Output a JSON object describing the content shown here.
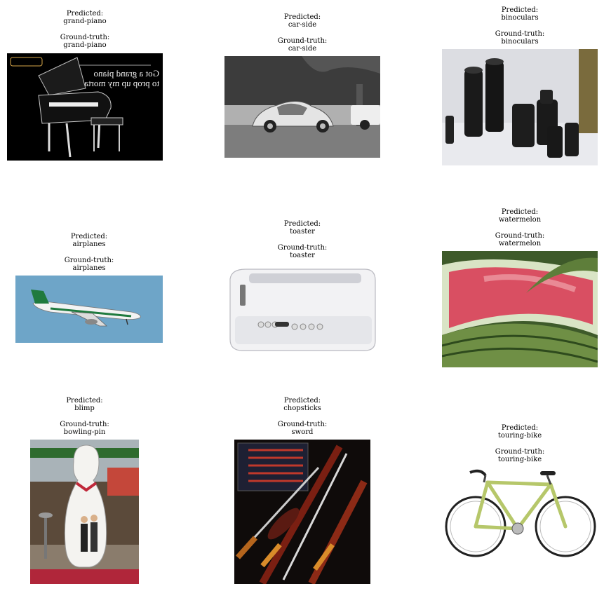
{
  "panels": [
    {
      "predicted_label": "Predicted:",
      "predicted": "grand-piano",
      "truth_label": "Ground-truth:",
      "truth": "grand-piano",
      "image_text": [
        "Got a grand piano",
        "to prop up my mortal remains"
      ]
    },
    {
      "predicted_label": "Predicted:",
      "predicted": "car-side",
      "truth_label": "Ground-truth:",
      "truth": "car-side"
    },
    {
      "predicted_label": "Predicted:",
      "predicted": "binoculars",
      "truth_label": "Ground-truth:",
      "truth": "binoculars"
    },
    {
      "predicted_label": "Predicted:",
      "predicted": "airplanes",
      "truth_label": "Ground-truth:",
      "truth": "airplanes"
    },
    {
      "predicted_label": "Predicted:",
      "predicted": "toaster",
      "truth_label": "Ground-truth:",
      "truth": "toaster"
    },
    {
      "predicted_label": "Predicted:",
      "predicted": "watermelon",
      "truth_label": "Ground-truth:",
      "truth": "watermelon"
    },
    {
      "predicted_label": "Predicted:",
      "predicted": "blimp",
      "truth_label": "Ground-truth:",
      "truth": "bowling-pin"
    },
    {
      "predicted_label": "Predicted:",
      "predicted": "chopsticks",
      "truth_label": "Ground-truth:",
      "truth": "sword"
    },
    {
      "predicted_label": "Predicted:",
      "predicted": "touring-bike",
      "truth_label": "Ground-truth:",
      "truth": "touring-bike"
    }
  ]
}
